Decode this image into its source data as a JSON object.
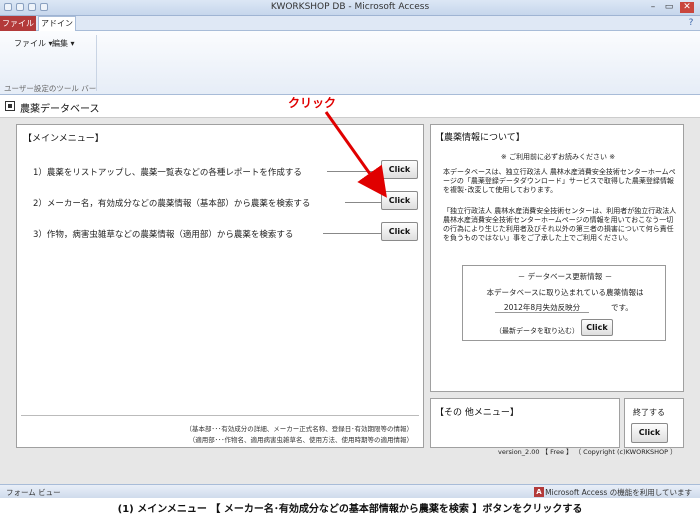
{
  "window": {
    "title": "KWORKSHOP DB  -  Microsoft Access",
    "controls": {
      "minimize": "–",
      "restore": "▭",
      "close": "✕",
      "help": "?"
    }
  },
  "ribbon": {
    "tabs": [
      {
        "label": "ファイル"
      },
      {
        "label": "アドイン"
      }
    ],
    "menus": [
      {
        "label": "ファイル ▾"
      },
      {
        "label": "編集 ▾"
      }
    ],
    "group_label": "ユーザー設定のツール バー"
  },
  "form": {
    "title": "農薬データベース"
  },
  "main_menu": {
    "title": "【メインメニュー】",
    "items": [
      {
        "text": "1）農薬をリストアップし、農薬一覧表などの各種レポートを作成する",
        "button": "Click"
      },
      {
        "text": "2）メーカー名，有効成分などの農薬情報（基本部）から農薬を検索する",
        "button": "Click"
      },
      {
        "text": "3）作物，病害虫雑草などの農薬情報（適用部）から農薬を検索する",
        "button": "Click"
      }
    ],
    "footnotes": [
      "（基本部･･･有効成分の詳細、メーカー正式名称、登録日･有効期限等の情報）",
      "（適用部･･･作物名、適用病害虫雑草名、使用方法、使用時期等の適用情報）"
    ]
  },
  "info": {
    "title": "【農薬情報について】",
    "notice": "※ ご利用前に必ずお読みください ※",
    "para1": "本データベースは、独立行政法人 農林水産消費安全技術センターホームページの「農薬登録データダウンロード」サービスで取得した農薬登録情報を複製･改変して使用しております。",
    "para2": "「独立行政法人 農林水産消費安全技術センターは、利用者が独立行政法人 農林水産消費安全技術センターホームページの情報を用いておこなう一切の行為により生じた利用者及びそれ以外の第三者の損害について何ら責任を負うものではない」事をご了承した上でご利用ください。",
    "update": {
      "title": "－ データベース更新情報 －",
      "line1": "本データベースに取り込まれている農薬情報は",
      "date": "2012年8月失効反映分",
      "suffix": "です。",
      "import_label": "（最新データを取り込む）",
      "button": "Click"
    }
  },
  "other_menu": {
    "title": "【その 他メニュー】"
  },
  "exit": {
    "label": "終了する",
    "button": "Click"
  },
  "version_text": "version_2.00 【 Free 】 （ Copyright (c)KWORKSHOP ）",
  "status": {
    "left": "フォーム ビュー",
    "right": "Microsoft Access の機能を利用しています",
    "icon_letter": "A"
  },
  "annotation": {
    "click_label": "クリック",
    "color": "#e00000"
  },
  "caption": "(1) メインメニュー 【 メーカー名･有効成分などの基本部情報から農薬を検索 】ボタンをクリックする"
}
